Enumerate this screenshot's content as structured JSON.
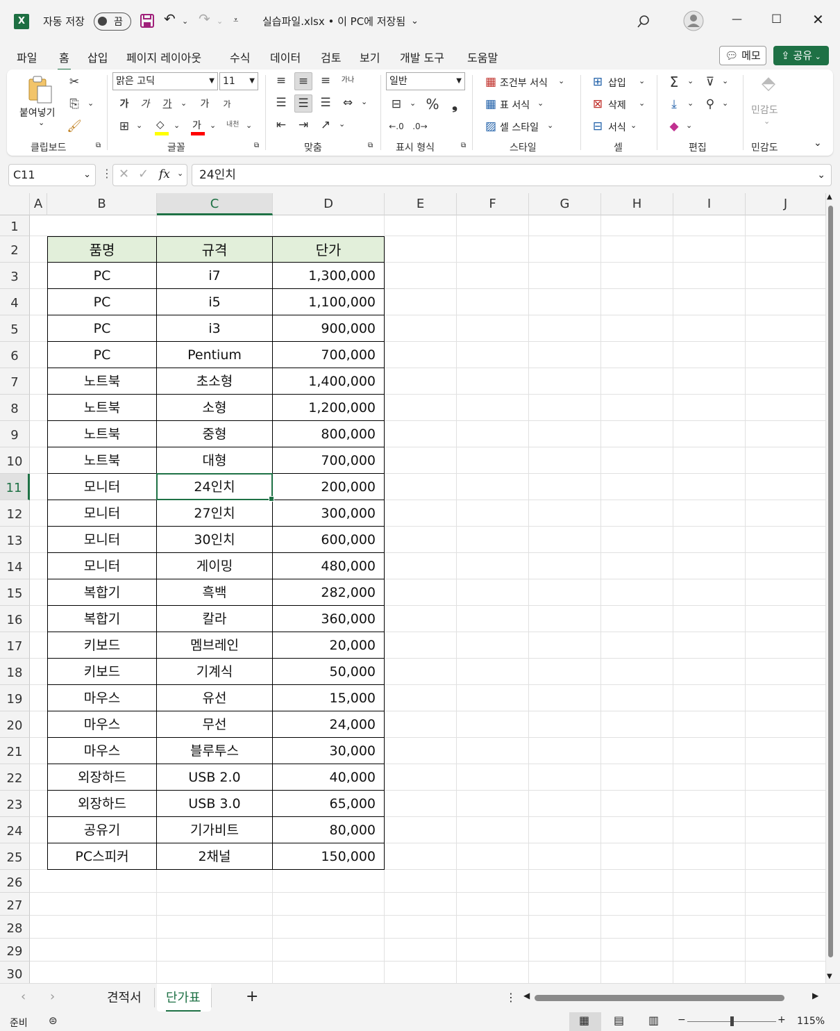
{
  "titlebar": {
    "autosave_label": "자동 저장",
    "autosave_state": "끔",
    "file_title": "실습파일.xlsx • 이 PC에 저장됨",
    "app_icon": "X"
  },
  "menu": {
    "tabs": [
      "파일",
      "홈",
      "삽입",
      "페이지 레이아웃",
      "수식",
      "데이터",
      "검토",
      "보기",
      "개발 도구",
      "도움말"
    ],
    "memo_label": "메모",
    "share_label": "공유"
  },
  "ribbon": {
    "clipboard": {
      "paste": "붙여넣기",
      "label": "클립보드"
    },
    "font": {
      "name": "맑은 고딕",
      "size": "11",
      "label": "글꼴",
      "bold": "가",
      "italic": "가",
      "underline": "가",
      "increase": "가",
      "decrease": "가",
      "color_glyph": "가",
      "phonetic": "내천"
    },
    "align": {
      "label": "맞춤",
      "wrap": "가나"
    },
    "number": {
      "format": "일반",
      "label": "표시 형식"
    },
    "styles": {
      "conditional": "조건부 서식",
      "table": "표 서식",
      "cell": "셀 스타일",
      "label": "스타일"
    },
    "cells": {
      "insert": "삽입",
      "delete": "삭제",
      "format": "서식",
      "label": "셀"
    },
    "editing": {
      "label": "편집"
    },
    "sensitivity": {
      "button": "민감도",
      "label": "민감도"
    }
  },
  "formula_bar": {
    "name_box": "C11",
    "fx": "fx",
    "content": "24인치"
  },
  "grid": {
    "columns": [
      "A",
      "B",
      "C",
      "D",
      "E",
      "F",
      "G",
      "H",
      "I",
      "J"
    ],
    "rows": [
      "1",
      "2",
      "3",
      "4",
      "5",
      "6",
      "7",
      "8",
      "9",
      "10",
      "11",
      "12",
      "13",
      "14",
      "15",
      "16",
      "17",
      "18",
      "19",
      "20",
      "21",
      "22",
      "23",
      "24",
      "25",
      "26",
      "27",
      "28",
      "29",
      "30"
    ],
    "selected_cell": "C11",
    "table_header": [
      "품명",
      "규격",
      "단가"
    ],
    "table_rows": [
      [
        "PC",
        "i7",
        "1,300,000"
      ],
      [
        "PC",
        "i5",
        "1,100,000"
      ],
      [
        "PC",
        "i3",
        "900,000"
      ],
      [
        "PC",
        "Pentium",
        "700,000"
      ],
      [
        "노트북",
        "초소형",
        "1,400,000"
      ],
      [
        "노트북",
        "소형",
        "1,200,000"
      ],
      [
        "노트북",
        "중형",
        "800,000"
      ],
      [
        "노트북",
        "대형",
        "700,000"
      ],
      [
        "모니터",
        "24인치",
        "200,000"
      ],
      [
        "모니터",
        "27인치",
        "300,000"
      ],
      [
        "모니터",
        "30인치",
        "600,000"
      ],
      [
        "모니터",
        "게이밍",
        "480,000"
      ],
      [
        "복합기",
        "흑백",
        "282,000"
      ],
      [
        "복합기",
        "칼라",
        "360,000"
      ],
      [
        "키보드",
        "멤브레인",
        "20,000"
      ],
      [
        "키보드",
        "기계식",
        "50,000"
      ],
      [
        "마우스",
        "유선",
        "15,000"
      ],
      [
        "마우스",
        "무선",
        "24,000"
      ],
      [
        "마우스",
        "블루투스",
        "30,000"
      ],
      [
        "외장하드",
        "USB 2.0",
        "40,000"
      ],
      [
        "외장하드",
        "USB 3.0",
        "65,000"
      ],
      [
        "공유기",
        "기가비트",
        "80,000"
      ],
      [
        "PC스피커",
        "2채널",
        "150,000"
      ]
    ],
    "header_fill": "#e2efda",
    "selection_color": "#1e7145"
  },
  "sheets": {
    "tabs": [
      "견적서",
      "단가표"
    ],
    "active": "단가표",
    "add": "+"
  },
  "status": {
    "ready": "준비",
    "zoom": "115%",
    "minus": "−",
    "plus": "+"
  }
}
